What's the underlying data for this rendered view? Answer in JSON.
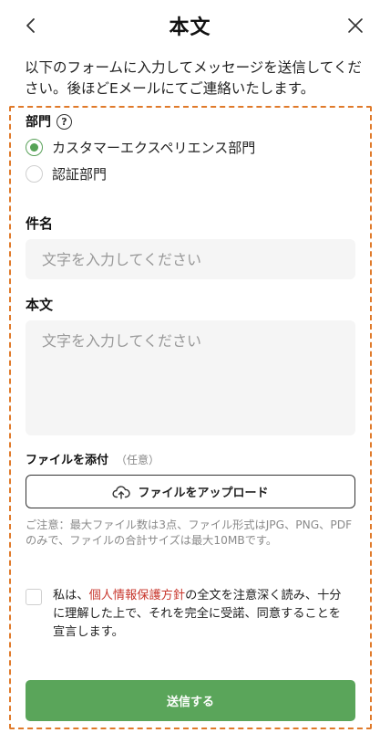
{
  "header": {
    "title": "本文",
    "back_icon": "chevron-left-icon",
    "close_icon": "close-icon"
  },
  "intro": "以下のフォームに入力してメッセージを送信してください。後ほどEメールにてご連絡いたします。",
  "department": {
    "label": "部門",
    "help_icon": "question-circle-icon",
    "options": [
      {
        "label": "カスタマーエクスペリエンス部門",
        "selected": true
      },
      {
        "label": "認証部門",
        "selected": false
      }
    ]
  },
  "subject": {
    "label": "件名",
    "placeholder": "文字を入力してください",
    "value": ""
  },
  "body": {
    "label": "本文",
    "placeholder": "文字を入力してください",
    "value": ""
  },
  "attachment": {
    "label": "ファイルを添付",
    "optional": "（任意）",
    "upload_label": "ファイルをアップロード",
    "upload_icon": "cloud-upload-icon",
    "notice": "ご注意：最大ファイル数は3点、ファイル形式はJPG、PNG、PDFのみで、ファイルの合計サイズは最大10MBです。"
  },
  "agreement": {
    "checked": false,
    "prefix": "私は、",
    "link": "個人情報保護方針",
    "suffix": "の全文を注意深く読み、十分に理解した上で、それを完全に受諾、同意することを宣言します。"
  },
  "submit_label": "送信する",
  "colors": {
    "accent_green": "#5aa55a",
    "frame_orange": "#e07a2a",
    "link_red": "#c8372d",
    "input_bg": "#f5f5f5"
  }
}
